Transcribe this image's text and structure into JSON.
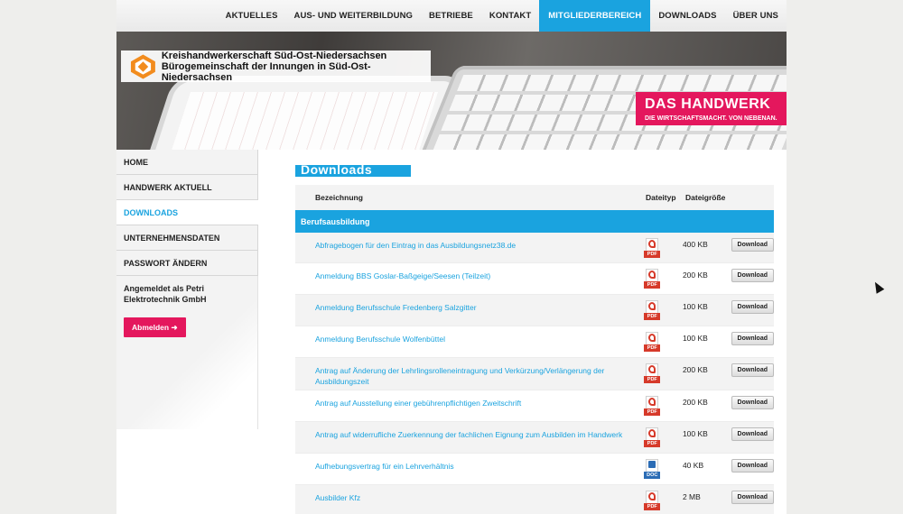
{
  "nav": {
    "items": [
      "AKTUELLES",
      "AUS- UND WEITERBILDUNG",
      "BETRIEBE",
      "KONTAKT",
      "MITGLIEDERBEREICH",
      "DOWNLOADS",
      "ÜBER UNS"
    ],
    "active_index": 4
  },
  "hero": {
    "title_line1": "Kreishandwerkerschaft Süd-Ost-Niedersachsen",
    "title_line2": "Bürogemeinschaft der Innungen in Süd-Ost-Niedersachsen",
    "badge_big": "DAS HANDWERK",
    "badge_small": "DIE WIRTSCHAFTSMACHT. VON NEBENAN."
  },
  "sidebar": {
    "items": [
      "HOME",
      "HANDWERK AKTUELL",
      "DOWNLOADS",
      "UNTERNEHMENSDATEN",
      "PASSWORT ÄNDERN"
    ],
    "active_index": 2,
    "login_text": "Angemeldet als Petri Elektrotechnik GmbH",
    "logout_label": "Abmelden ➜"
  },
  "main": {
    "heading": "Downloads",
    "columns": {
      "name": "Bezeichnung",
      "type": "Dateityp",
      "size": "Dateigröße"
    },
    "section": "Berufsausbildung",
    "rows": [
      {
        "name": "Abfragebogen für den Eintrag in das Ausbildungsnetz38.de",
        "type": "PDF",
        "size": "400 KB",
        "action": "Download"
      },
      {
        "name": "Anmeldung BBS Goslar-Baßgeige/Seesen (Teilzeit)",
        "type": "PDF",
        "size": "200 KB",
        "action": "Download"
      },
      {
        "name": "Anmeldung Berufsschule Fredenberg Salzgitter",
        "type": "PDF",
        "size": "100 KB",
        "action": "Download"
      },
      {
        "name": "Anmeldung Berufsschule Wolfenbüttel",
        "type": "PDF",
        "size": "100 KB",
        "action": "Download"
      },
      {
        "name": "Antrag auf Änderung der Lehrlingsrolleneintragung und Verkürzung/Verlängerung der Ausbildungszeit",
        "type": "PDF",
        "size": "200 KB",
        "action": "Download"
      },
      {
        "name": "Antrag auf Ausstellung einer gebührenpflichtigen Zweitschrift",
        "type": "PDF",
        "size": "200 KB",
        "action": "Download"
      },
      {
        "name": "Antrag auf widerrufliche Zuerkennung der fachlichen Eignung zum Ausbilden im Handwerk",
        "type": "PDF",
        "size": "100 KB",
        "action": "Download"
      },
      {
        "name": "Aufhebungsvertrag für ein Lehrverhältnis",
        "type": "DOC",
        "size": "40 KB",
        "action": "Download"
      },
      {
        "name": "Ausbilder Kfz",
        "type": "PDF",
        "size": "2 MB",
        "action": "Download"
      }
    ]
  },
  "colors": {
    "accent": "#1aa3df",
    "brand_pink": "#e4175d"
  }
}
